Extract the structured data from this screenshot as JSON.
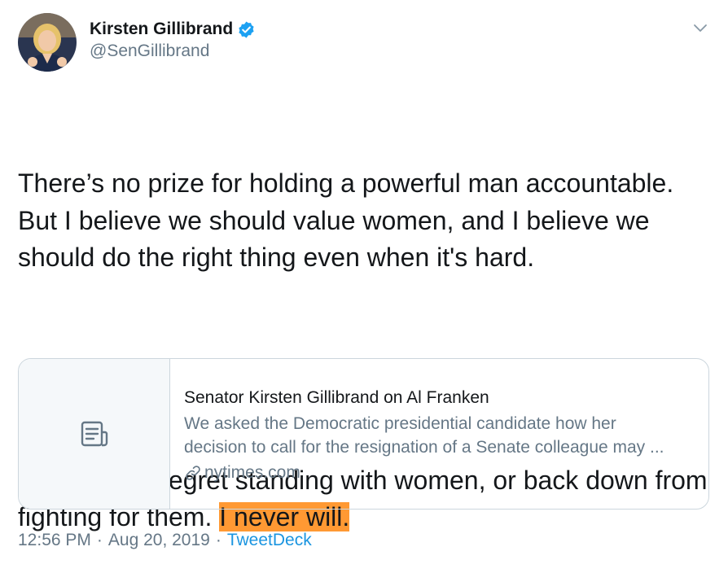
{
  "author": {
    "display_name": "Kirsten Gillibrand",
    "handle": "@SenGillibrand",
    "verified": true
  },
  "tweet": {
    "paragraph1": "There’s no prize for holding a powerful man accountable. But I believe we should value women, and I believe we should do the right thing even when it's hard.",
    "paragraph2_before": "Others may regret standing with women, or back down from fighting for them. ",
    "paragraph2_highlight": "I never will."
  },
  "card": {
    "title": "Senator Kirsten Gillibrand on Al Franken",
    "description_line1": "We asked the Democratic presidential candidate how her",
    "description_line2": "decision to call for the resignation of a Senate colleague may ...",
    "domain": "nytimes.com",
    "thumb_icon": "document-icon"
  },
  "meta": {
    "time": "12:56 PM",
    "separator": "·",
    "date": "Aug 20, 2019",
    "source": "TweetDeck"
  },
  "colors": {
    "text": "#14171a",
    "secondary": "#657786",
    "link": "#1b95e0",
    "verified": "#1da1f2",
    "highlight": "#ff9933",
    "border": "#ccd6dd"
  }
}
